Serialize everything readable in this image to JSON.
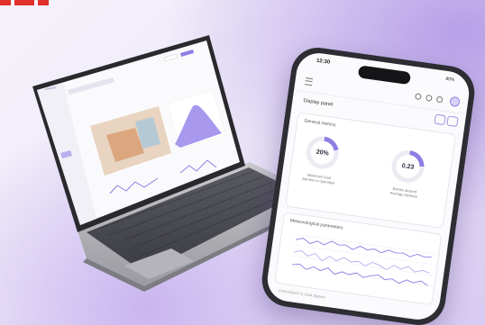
{
  "phone": {
    "status_time": "12:30",
    "status_battery": "80%",
    "page_title": "Display panel",
    "card1_title": "General metrics",
    "gauge1": {
      "value": "20%",
      "fraction": 0.2,
      "label1": "Maximum load",
      "label2": "Barriers in operation"
    },
    "gauge2": {
      "value": "0.23",
      "fraction": 0.23,
      "label1": "Entries desired",
      "label2": "Average distance"
    },
    "card2_title": "Meteorological parameters",
    "footer": "COPYRIGHT © 2024 Skytrax"
  },
  "colors": {
    "accent": "#8d7ee3",
    "accent_light": "#b9aef0",
    "phone_body": "#2d2d33",
    "red_mark": "#e0302a"
  }
}
